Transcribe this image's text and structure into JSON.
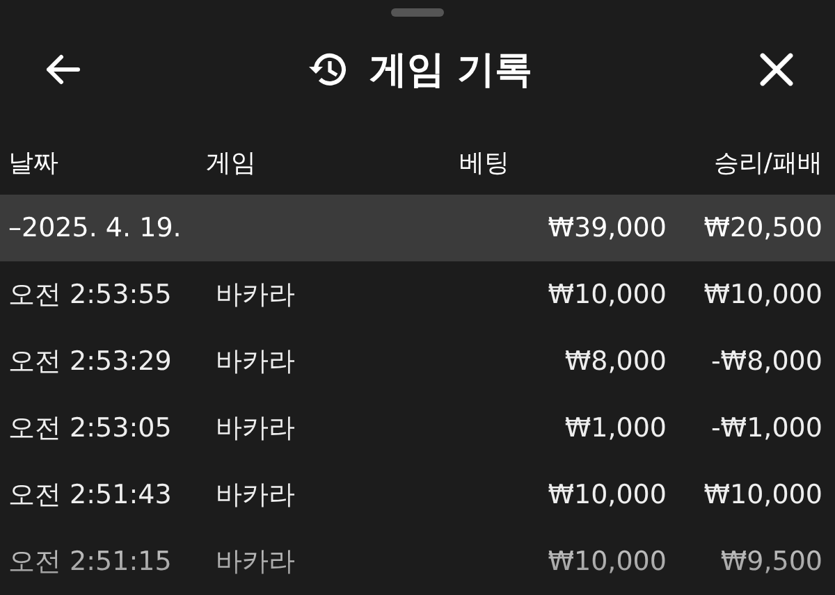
{
  "header": {
    "title": "게임 기록"
  },
  "columns": [
    "날짜",
    "게임",
    "베팅",
    "승리/패배"
  ],
  "group": {
    "label": "–2025. 4. 19.",
    "bet": "₩39,000",
    "result": "₩20,500"
  },
  "rows": [
    {
      "time": "오전 2:53:55",
      "game": "바카라",
      "bet": "₩10,000",
      "result": "₩10,000"
    },
    {
      "time": "오전 2:53:29",
      "game": "바카라",
      "bet": "₩8,000",
      "result": "-₩8,000"
    },
    {
      "time": "오전 2:53:05",
      "game": "바카라",
      "bet": "₩1,000",
      "result": "-₩1,000"
    },
    {
      "time": "오전 2:51:43",
      "game": "바카라",
      "bet": "₩10,000",
      "result": "₩10,000"
    },
    {
      "time": "오전 2:51:15",
      "game": "바카라",
      "bet": "₩10,000",
      "result": "₩9,500"
    }
  ]
}
